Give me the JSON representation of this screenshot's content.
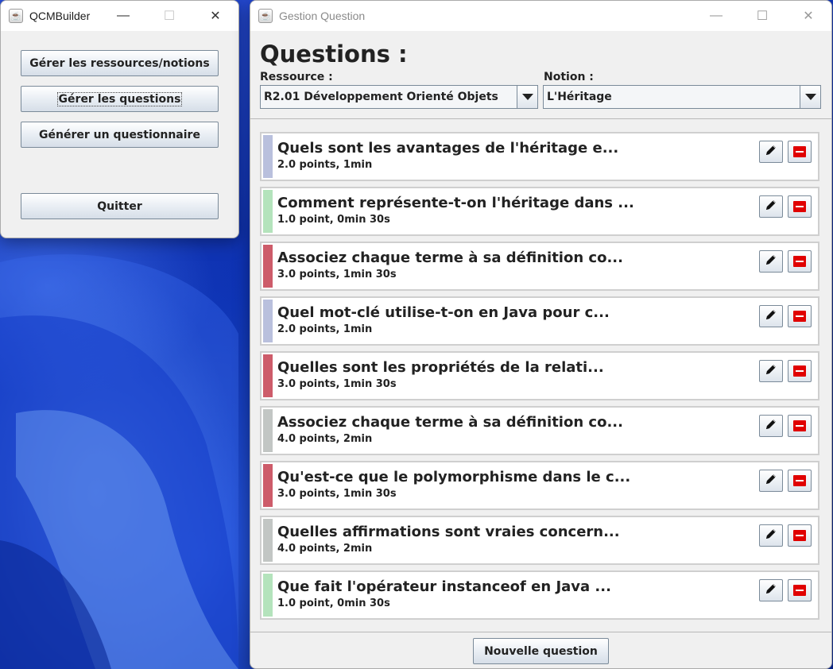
{
  "main_window": {
    "title": "QCMBuilder",
    "buttons": {
      "manage_resources": "Gérer les ressources/notions",
      "manage_questions": "Gérer les questions",
      "generate_quiz": "Générer un questionnaire",
      "quit": "Quitter"
    }
  },
  "question_window": {
    "title": "Gestion Question",
    "heading": "Questions :",
    "resource_label": "Ressource :",
    "resource_value": "R2.01 Développement Orienté Objets",
    "notion_label": "Notion :",
    "notion_value": "L'Héritage",
    "new_question_button": "Nouvelle question",
    "questions": [
      {
        "title": "Quels sont les avantages de l'héritage e...",
        "meta": "2.0 points, 1min",
        "color": "#b9c0dd"
      },
      {
        "title": "Comment représente-t-on l'héritage dans ...",
        "meta": "1.0 point, 0min 30s",
        "color": "#b4e3bc"
      },
      {
        "title": "Associez chaque terme à sa définition co...",
        "meta": "3.0 points, 1min 30s",
        "color": "#cd5c6a"
      },
      {
        "title": "Quel mot-clé utilise-t-on en Java pour c...",
        "meta": "2.0 points, 1min",
        "color": "#b9c0dd"
      },
      {
        "title": "Quelles sont les propriétés de la relati...",
        "meta": "3.0 points, 1min 30s",
        "color": "#cd5c6a"
      },
      {
        "title": "Associez chaque terme à sa définition co...",
        "meta": "4.0 points, 2min",
        "color": "#c2c6c4"
      },
      {
        "title": "Qu'est-ce que le polymorphisme dans le c...",
        "meta": "3.0 points, 1min 30s",
        "color": "#cd5c6a"
      },
      {
        "title": "Quelles affirmations sont vraies concern...",
        "meta": "4.0 points, 2min",
        "color": "#c2c6c4"
      },
      {
        "title": "Que fait l'opérateur instanceof en Java ...",
        "meta": "1.0 point, 0min 30s",
        "color": "#b4e3bc"
      }
    ]
  },
  "icons": {
    "app": "java-cup-icon",
    "edit": "pencil-icon",
    "delete": "minus-icon",
    "minimize": "minimize-icon",
    "maximize": "maximize-icon",
    "close": "close-icon"
  }
}
